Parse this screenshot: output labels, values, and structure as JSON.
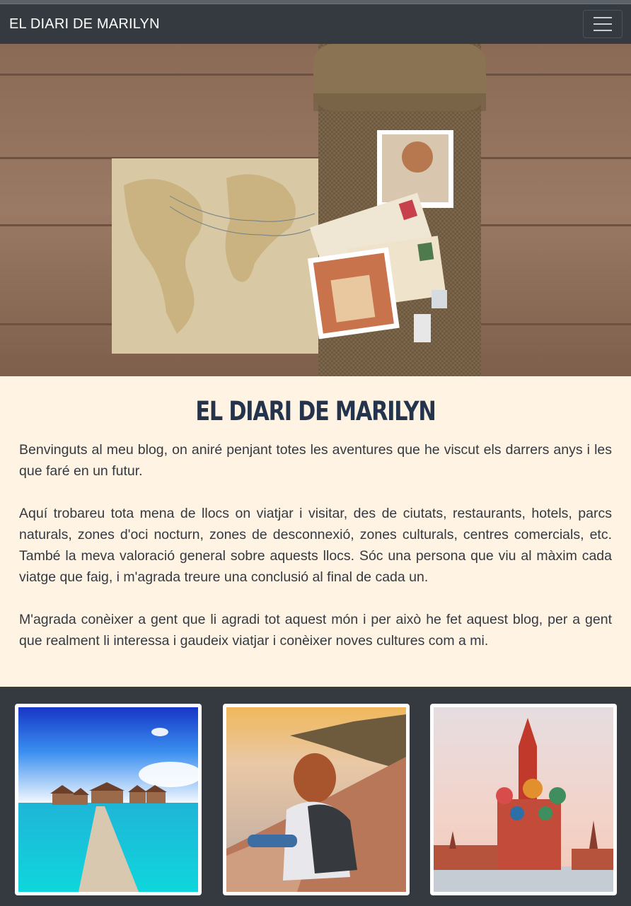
{
  "navbar": {
    "brand": "EL DIARI DE MARILYN",
    "toggler_icon": "hamburger-icon"
  },
  "hero": {
    "image": "vintage world map with postcards on burlap over wooden table"
  },
  "intro": {
    "title": "EL DIARI DE MARILYN",
    "paragraphs": [
      "Benvinguts al meu blog, on aniré penjant totes les aventures que he viscut els darrers anys i les que faré en un futur.",
      "Aquí trobareu tota mena de llocs on viatjar i visitar, des de ciutats, restaurants, hotels, parcs naturals, zones d'oci nocturn, zones de desconnexió, zones culturals, centres comercials, etc. També la meva valoració general sobre aquests llocs. Sóc una persona que viu al màxim cada viatge que faig, i m'agrada treure una conclusió al final de cada un.",
      "M'agrada conèixer a gent que li agradi tot aquest món i per això he fet aquest blog, per a gent que realment li interessa i gaudeix viatjar i conèixer noves cultures com a mi."
    ]
  },
  "gallery": [
    {
      "image": "overwater bungalows with wooden pier in turquoise sea"
    },
    {
      "image": "woman with backpack sitting on cliff at sunset by the sea"
    },
    {
      "image": "Saint Basil's Cathedral, Red Square, Moscow"
    }
  ]
}
